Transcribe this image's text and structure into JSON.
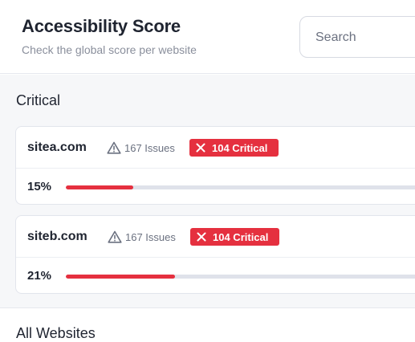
{
  "header": {
    "title": "Accessibility Score",
    "subtitle": "Check the global score per website",
    "search": {
      "placeholder": "Search"
    }
  },
  "critical_section": {
    "title": "Critical",
    "sites": [
      {
        "name": "sitea.com",
        "issues": "167 Issues",
        "badge": "104 Critical",
        "percent_label": "15%",
        "score_fraction": 0.19
      },
      {
        "name": "siteb.com",
        "issues": "167 Issues",
        "badge": "104 Critical",
        "percent_label": "21%",
        "score_fraction": 0.31
      }
    ]
  },
  "all_section": {
    "title": "All Websites"
  },
  "colors": {
    "accent_red": "#e5303f",
    "track": "#dfe2ea",
    "text": "#1f2430",
    "muted": "#8a8f9c"
  },
  "icons": {
    "issues": "warning-triangle-icon",
    "badge": "close-x-icon"
  }
}
